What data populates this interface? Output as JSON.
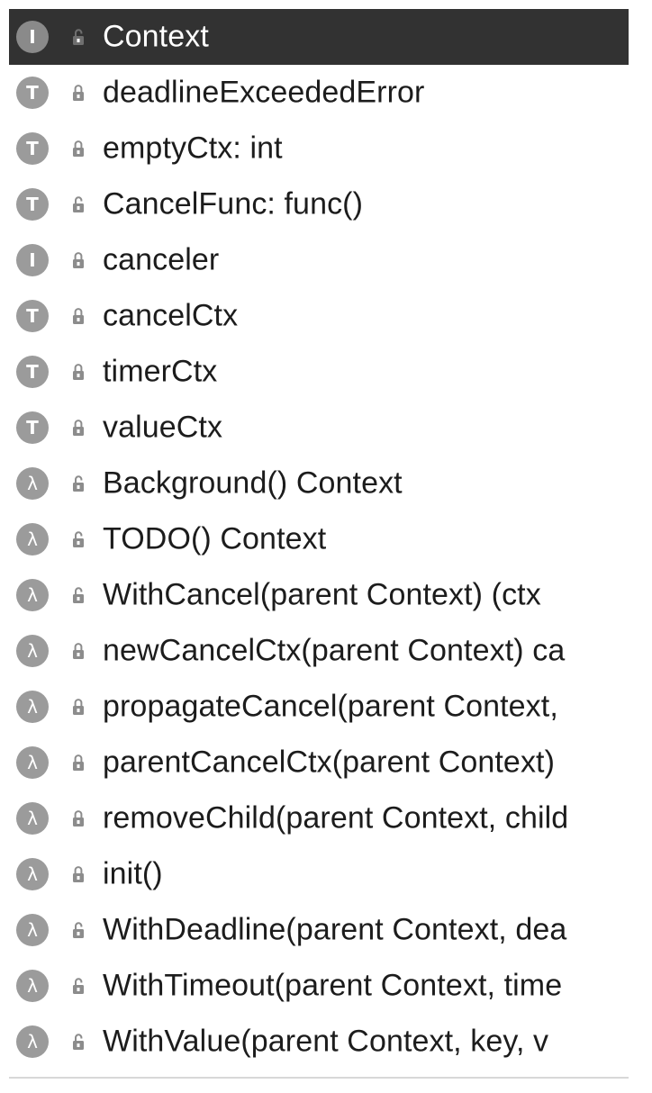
{
  "colors": {
    "selected_row_bg": "#323232",
    "badge_bg": "#9b9b9b",
    "text": "#1c1c1c",
    "selected_text": "#ffffff"
  },
  "structure": {
    "selected_index": 0,
    "items": [
      {
        "kind": "interface",
        "badge": "I",
        "visibility": "exported",
        "icon": "unlock-icon",
        "label": "Context"
      },
      {
        "kind": "type",
        "badge": "T",
        "visibility": "private",
        "icon": "lock-icon",
        "label": "deadlineExceededError"
      },
      {
        "kind": "type",
        "badge": "T",
        "visibility": "private",
        "icon": "lock-icon",
        "label": "emptyCtx: int"
      },
      {
        "kind": "type",
        "badge": "T",
        "visibility": "exported",
        "icon": "unlock-icon",
        "label": "CancelFunc: func()"
      },
      {
        "kind": "interface",
        "badge": "I",
        "visibility": "private",
        "icon": "lock-icon",
        "label": "canceler"
      },
      {
        "kind": "type",
        "badge": "T",
        "visibility": "private",
        "icon": "lock-icon",
        "label": "cancelCtx"
      },
      {
        "kind": "type",
        "badge": "T",
        "visibility": "private",
        "icon": "lock-icon",
        "label": "timerCtx"
      },
      {
        "kind": "type",
        "badge": "T",
        "visibility": "private",
        "icon": "lock-icon",
        "label": "valueCtx"
      },
      {
        "kind": "function",
        "badge": "λ",
        "visibility": "exported",
        "icon": "unlock-icon",
        "label": "Background() Context"
      },
      {
        "kind": "function",
        "badge": "λ",
        "visibility": "exported",
        "icon": "unlock-icon",
        "label": "TODO() Context"
      },
      {
        "kind": "function",
        "badge": "λ",
        "visibility": "exported",
        "icon": "unlock-icon",
        "label": "WithCancel(parent Context) (ctx"
      },
      {
        "kind": "function",
        "badge": "λ",
        "visibility": "private",
        "icon": "lock-icon",
        "label": "newCancelCtx(parent Context) ca"
      },
      {
        "kind": "function",
        "badge": "λ",
        "visibility": "private",
        "icon": "lock-icon",
        "label": "propagateCancel(parent Context,"
      },
      {
        "kind": "function",
        "badge": "λ",
        "visibility": "private",
        "icon": "lock-icon",
        "label": "parentCancelCtx(parent Context)"
      },
      {
        "kind": "function",
        "badge": "λ",
        "visibility": "private",
        "icon": "lock-icon",
        "label": "removeChild(parent Context, child"
      },
      {
        "kind": "function",
        "badge": "λ",
        "visibility": "private",
        "icon": "lock-icon",
        "label": "init()"
      },
      {
        "kind": "function",
        "badge": "λ",
        "visibility": "exported",
        "icon": "unlock-icon",
        "label": "WithDeadline(parent Context, dea"
      },
      {
        "kind": "function",
        "badge": "λ",
        "visibility": "exported",
        "icon": "unlock-icon",
        "label": "WithTimeout(parent Context, time"
      },
      {
        "kind": "function",
        "badge": "λ",
        "visibility": "exported",
        "icon": "unlock-icon",
        "label": "WithValue(parent Context, key, v"
      }
    ]
  }
}
